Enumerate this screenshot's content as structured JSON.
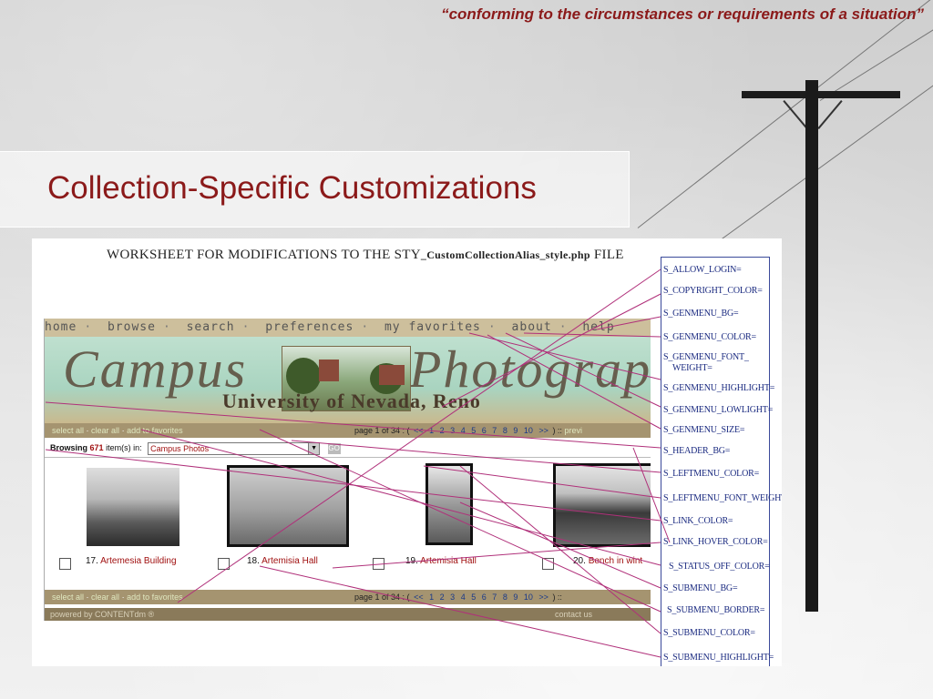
{
  "quote": "“conforming to the circumstances or requirements of a situation”",
  "slide_title": "Collection-Specific Customizations",
  "worksheet": {
    "title_prefix": "WORKSHEET FOR MODIFICATIONS TO THE STY",
    "title_file": "_CustomCollectionAlias_style.php",
    "title_suffix": " FILE"
  },
  "variables": [
    "S_ALLOW_LOGIN=",
    "S_COPYRIGHT_COLOR=",
    "S_GENMENU_BG=",
    "S_GENMENU_COLOR=",
    "S_GENMENU_FONT_",
    "WEIGHT=",
    "S_GENMENU_HIGHLIGHT=",
    "S_GENMENU_LOWLIGHT=",
    "S_GENMENU_SIZE=",
    "S_HEADER_BG=",
    "S_LEFTMENU_COLOR=",
    "S_LEFTMENU_FONT_WEIGHT=",
    "S_LINK_COLOR=",
    "S_LINK_HOVER_COLOR=",
    "S_STATUS_OFF_COLOR=",
    "S_SUBMENU_BG=",
    "S_SUBMENU_BORDER=",
    "S_SUBMENU_COLOR=",
    "S_SUBMENU_HIGHLIGHT="
  ],
  "site": {
    "nav": [
      "home",
      "browse",
      "search",
      "preferences",
      "my favorites",
      "about",
      "help"
    ],
    "nav_sep": "·",
    "banner_script_left": "Campus",
    "banner_script_right": "Photograph",
    "banner_subtitle": "University of Nevada, Reno",
    "toolbar": {
      "select_all": "select all",
      "clear_all": "clear all",
      "add_favorites": "add to favorites",
      "dot": "·",
      "page_label": "page 1 of 34 : (",
      "prev_arrow": "<<",
      "pages": [
        "1",
        "2",
        "3",
        "4",
        "5",
        "6",
        "7",
        "8",
        "9",
        "10"
      ],
      "next_arrow": ">>",
      "page_close": ") ::",
      "prev_link": "previ"
    },
    "browse": {
      "label": "Browsing",
      "count": "671",
      "suffix": "item(s) in:",
      "collection": "Campus Photos",
      "dropdown_arrow": "▼",
      "go": "GO"
    },
    "items": [
      {
        "num": "17.",
        "title": "Artemesia Building"
      },
      {
        "num": "18.",
        "title": "Artemisia Hall"
      },
      {
        "num": "19.",
        "title": "Artemisia Hall"
      },
      {
        "num": "20.",
        "title": "Bench in wint"
      }
    ],
    "footer": "powered by CONTENTdm ®",
    "footer_right": "contact us"
  },
  "colors": {
    "accent_red": "#8b1a1a",
    "line_color": "#b0307a",
    "var_blue": "#1a2a80",
    "nav_bg": "#cdbf9c",
    "toolbar_bg": "#a59470"
  }
}
